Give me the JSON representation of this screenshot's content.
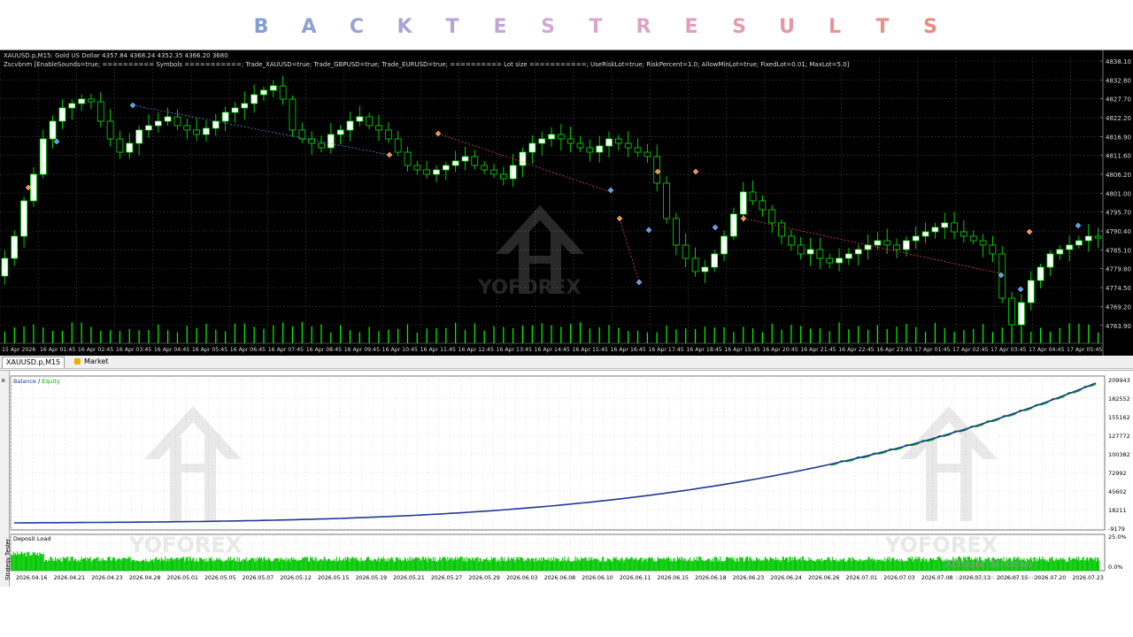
{
  "banner": {
    "letters": [
      "B",
      "A",
      "C",
      "K",
      "T",
      "E",
      "S",
      "T",
      "R",
      "E",
      "S",
      "U",
      "L",
      "T",
      "S"
    ],
    "colors": [
      "#7f9fd6",
      "#8ca2d6",
      "#9aa3d6",
      "#a8a4d6",
      "#b6a5d6",
      "#c4a6d6",
      "#d2a7d6",
      "#d8a6d0",
      "#dca3c6",
      "#e09fbb",
      "#e39bb0",
      "#e697a4",
      "#e89398",
      "#e98f8c",
      "#ea8a80"
    ]
  },
  "chart": {
    "title": "XAUUSD.p,M15:  Gold US Dollar  4357.84 4368.24 4352.35 4366.20  3680",
    "params": "Zscvbnm [EnableSounds=true; ========== Symbols ===========; Trade_XAUUSD=true; Trade_GBPUSD=true; Trade_EURUSD=true; ========== Lot size ===========; UseRiskLot=true; RiskPercent=1.0; AllowMinLot=true; FixedLot=0.01; MaxLot=5.0]",
    "price_labels": [
      "4838.10",
      "4832.80",
      "4827.70",
      "4822.20",
      "4816.90",
      "4811.60",
      "4806.20",
      "4801.00",
      "4795.70",
      "4790.40",
      "4785.10",
      "4779.80",
      "4774.50",
      "4769.20",
      "4763.90"
    ],
    "time_labels": [
      "15 Apr 2026",
      "16 Apr 01:45",
      "16 Apr 02:45",
      "16 Apr 03:45",
      "16 Apr 04:45",
      "16 Apr 05:45",
      "16 Apr 06:45",
      "16 Apr 07:45",
      "16 Apr 08:45",
      "16 Apr 09:45",
      "16 Apr 10:45",
      "16 Apr 11:45",
      "16 Apr 12:45",
      "16 Apr 13:45",
      "16 Apr 14:45",
      "16 Apr 15:45",
      "16 Apr 16:45",
      "16 Apr 17:45",
      "16 Apr 18:45",
      "16 Apr 15:45",
      "16 Apr 20:45",
      "16 Apr 21:45",
      "16 Apr 22:45",
      "16 Apr 23:45",
      "17 Apr 01:45",
      "17 Apr 02:45",
      "17 Apr 03:45",
      "17 Apr 04:45",
      "17 Apr 05:45"
    ],
    "watermark": "YOFOREX"
  },
  "tabs": {
    "active": "XAUUSD.p,M15",
    "market": "Market"
  },
  "tester": {
    "side_label": "Strategy Tester",
    "close_glyph": "×",
    "legend_balance": "Balance",
    "legend_sep": " / ",
    "legend_equity": "Equity",
    "balance_labels": [
      "209943",
      "182552",
      "155162",
      "127772",
      "100382",
      "72992",
      "45602",
      "18211",
      "-9179"
    ],
    "deposit_title": "Deposit Load",
    "deposit_labels": [
      "25.0%",
      "0.0%"
    ],
    "date_labels": [
      "2026.04.16",
      "2026.04.21",
      "2026.04.23",
      "2026.04.28",
      "2026.05.01",
      "2026.05.05",
      "2026.05.07",
      "2026.05.12",
      "2026.05.15",
      "2026.05.19",
      "2026.05.21",
      "2026.05.27",
      "2026.05.29",
      "2026.06.03",
      "2026.06.08",
      "2026.06.10",
      "2026.06.11",
      "2026.06.15",
      "2026.06.18",
      "2026.06.23",
      "2026.06.24",
      "2026.06.26",
      "2026.07.01",
      "2026.07.03",
      "2026.07.08",
      "2026.07.13",
      "2026.07.15",
      "2026.07.20",
      "2026.07.23"
    ],
    "watermark": "YOFOREX",
    "activate_title": "Activate Windows",
    "activate_sub": "Go to Settings to activate Windows."
  },
  "colors": {
    "bull": "#ffffff",
    "bear": "#000000",
    "wick": "#00ff00",
    "volume": "#00ff00",
    "balance": "#1f3a93",
    "equity": "#00b000",
    "deposit": "#00c800"
  }
}
